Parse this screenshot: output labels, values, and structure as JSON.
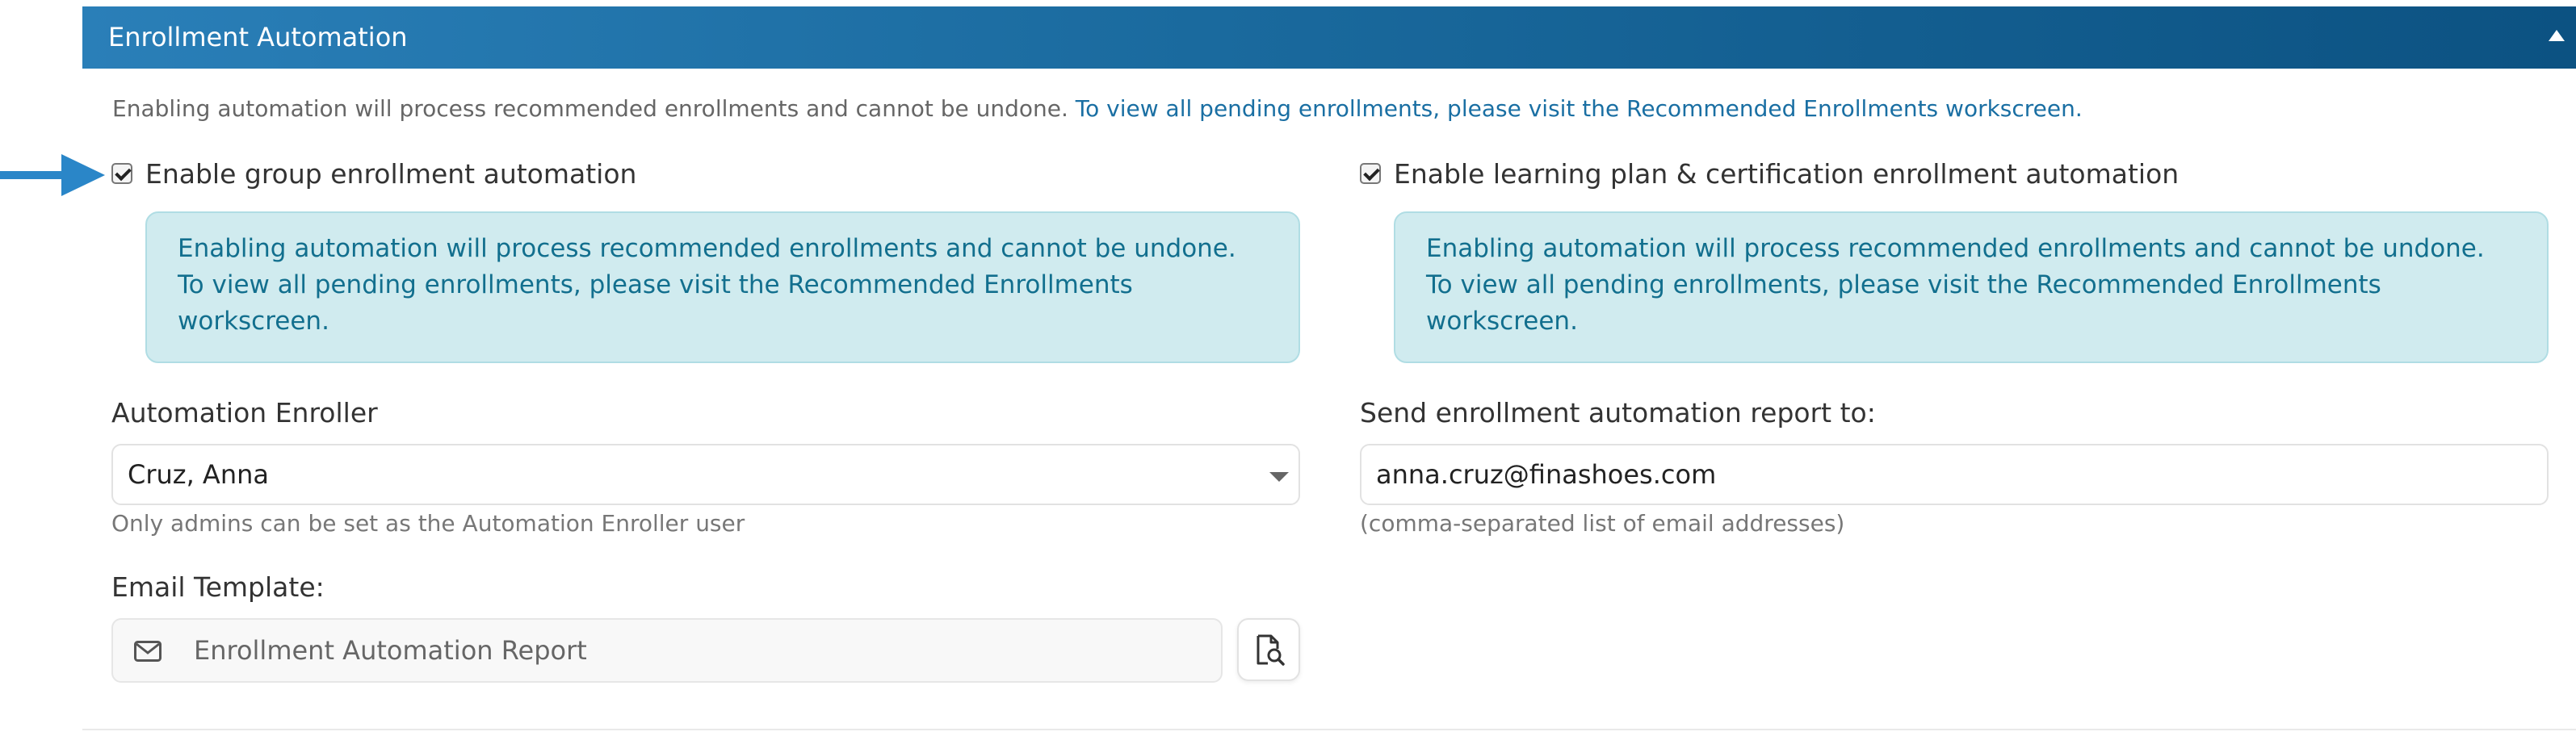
{
  "panel": {
    "title": "Enrollment Automation",
    "collapse_icon": "chevron-up-icon",
    "description_text": "Enabling automation will process recommended enrollments and cannot be undone.",
    "description_link": "To view all pending enrollments, please visit the Recommended Enrollments workscreen."
  },
  "group": {
    "checkbox_label": "Enable group enrollment automation",
    "checked": true,
    "alert_line1": "Enabling automation will process recommended enrollments and cannot be undone.",
    "alert_line2": "To view all pending enrollments, please visit the Recommended Enrollments",
    "alert_line3": "workscreen.",
    "enroller_label": "Automation Enroller",
    "enroller_value": "Cruz, Anna",
    "enroller_help": "Only admins can be set as the Automation Enroller user",
    "template_label": "Email Template:",
    "template_value": "Enrollment Automation Report"
  },
  "learning": {
    "checkbox_label": "Enable learning plan & certification enrollment automation",
    "checked": true,
    "alert_line1": "Enabling automation will process recommended enrollments and cannot be undone.",
    "alert_line2": "To view all pending enrollments, please visit the Recommended Enrollments",
    "alert_line3": "workscreen.",
    "report_label": "Send enrollment automation report to:",
    "report_value": "anna.cruz@finashoes.com",
    "report_help": "(comma-separated list of email addresses)"
  },
  "colors": {
    "header_start": "#2a7fb8",
    "header_end": "#0c5282",
    "link": "#1a6fa3",
    "alert_bg": "#d0ebef",
    "alert_text": "#126f8e",
    "pointer_arrow": "#2a86c8"
  }
}
